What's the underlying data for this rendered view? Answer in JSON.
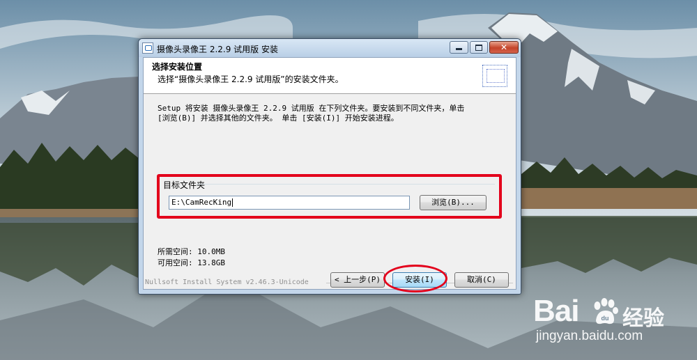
{
  "window": {
    "title": "摄像头录像王 2.2.9 试用版 安装",
    "min_icon": "minimize-icon",
    "max_icon": "maximize-icon",
    "close_glyph": "✕"
  },
  "header": {
    "title": "选择安装位置",
    "subtitle": "选择“摄像头录像王 2.2.9 试用版”的安装文件夹。"
  },
  "description": {
    "line1": "Setup 将安装 摄像头录像王 2.2.9 试用版 在下列文件夹。要安装到不同文件夹，单击",
    "line2": "[浏览(B)] 并选择其他的文件夹。 单击 [安装(I)] 开始安装进程。"
  },
  "destination": {
    "group_label": "目标文件夹",
    "path": "E:\\CamRecKing",
    "browse_label": "浏览(B)..."
  },
  "space": {
    "required": "所需空间: 10.0MB",
    "available": "可用空间: 13.8GB"
  },
  "footer": {
    "brand": "Nullsoft Install System v2.46.3-Unicode",
    "back_label": "< 上一步(P)",
    "install_label": "安装(I)",
    "cancel_label": "取消(C)"
  },
  "watermark": {
    "brand": "Bai",
    "text": "经验",
    "url": "jingyan.baidu.com"
  },
  "colors": {
    "highlight": "#e3001b",
    "title_bar": "#c3d6ea"
  }
}
